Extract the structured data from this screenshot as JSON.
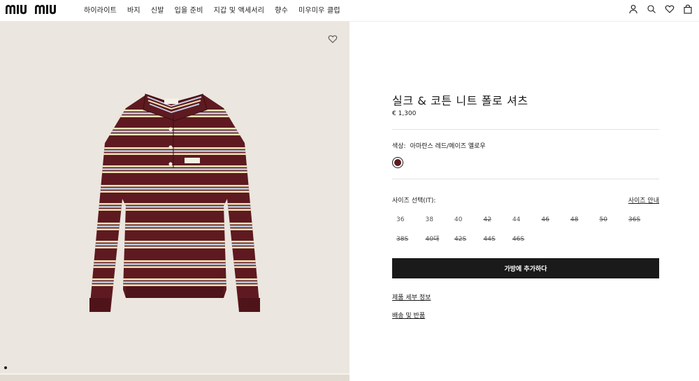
{
  "header": {
    "logo_text": "MIU MIU",
    "nav": [
      "하이라이트",
      "바지",
      "신발",
      "입을 준비",
      "지갑 및 액세서리",
      "향수",
      "미우미우 클럽"
    ],
    "icons": [
      "user-icon",
      "search-icon",
      "heart-icon",
      "bag-icon"
    ]
  },
  "product": {
    "title": "실크 & 코튼 니트 폴로 셔츠",
    "price": "€ 1,300",
    "color_label": "색상:",
    "color_value": "아마란스 레드/메이즈 옐로우",
    "swatch_color": "#5e1a20",
    "size_label": "사이즈 선택(IT):",
    "size_guide": "사이즈 안내",
    "sizes": [
      {
        "label": "36",
        "available": true
      },
      {
        "label": "38",
        "available": true
      },
      {
        "label": "40",
        "available": true
      },
      {
        "label": "42",
        "available": false
      },
      {
        "label": "44",
        "available": true
      },
      {
        "label": "46",
        "available": false
      },
      {
        "label": "48",
        "available": false
      },
      {
        "label": "50",
        "available": false
      },
      {
        "label": "36S",
        "available": false
      },
      {
        "label": "38S",
        "available": false
      },
      {
        "label": "40대",
        "available": false
      },
      {
        "label": "42S",
        "available": false
      },
      {
        "label": "44S",
        "available": false
      },
      {
        "label": "46S",
        "available": false
      }
    ],
    "add_to_bag": "가방에 추가하다",
    "details_link": "제품 세부 정보",
    "shipping_link": "배송 및 반품"
  },
  "gallery": {
    "background": "#ebe6df",
    "garment_base": "#5e1a20",
    "stripe_colors": [
      "#f1e2b3",
      "#c3cde3"
    ]
  }
}
